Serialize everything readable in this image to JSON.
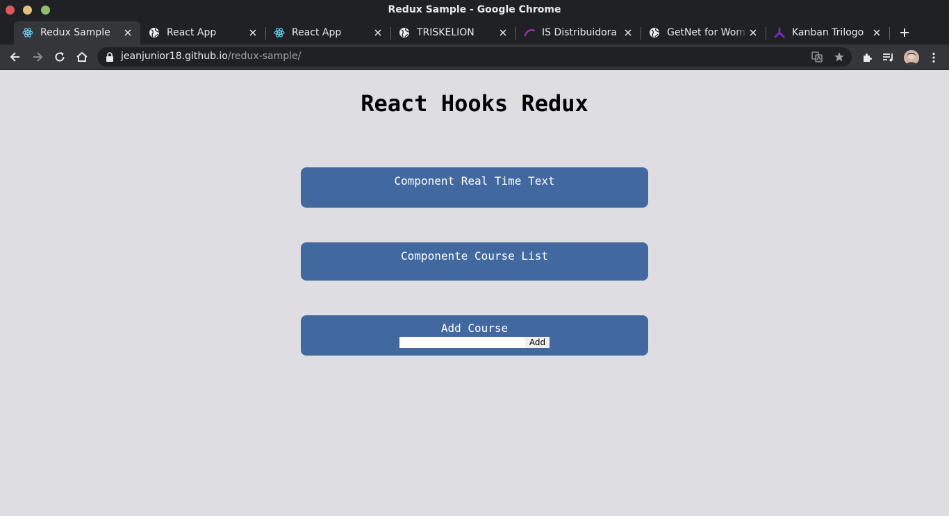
{
  "window": {
    "title": "Redux Sample - Google Chrome"
  },
  "tabs": [
    {
      "label": "Redux Sample",
      "icon": "react-icon"
    },
    {
      "label": "React App",
      "icon": "globe-icon"
    },
    {
      "label": "React App",
      "icon": "react-icon"
    },
    {
      "label": "TRISKELION",
      "icon": "globe-icon"
    },
    {
      "label": "IS Distribuidora",
      "icon": "swoosh-icon"
    },
    {
      "label": "GetNet for Wom",
      "icon": "globe-icon"
    },
    {
      "label": "Kanban Trilogo",
      "icon": "trilogo-icon"
    }
  ],
  "address": {
    "host": "jeanjunior18.github.io",
    "path": "/redux-sample/"
  },
  "page": {
    "title": "React Hooks Redux",
    "realtime_card": {
      "heading": "Component Real Time Text"
    },
    "course_list_card": {
      "heading": "Componente Course List"
    },
    "add_course_card": {
      "heading": "Add Course",
      "input_value": "",
      "button_label": "Add"
    }
  },
  "colors": {
    "card": "#41699f",
    "background": "#dedde2",
    "chrome_dark": "#202124",
    "chrome_toolbar": "#35363a"
  }
}
